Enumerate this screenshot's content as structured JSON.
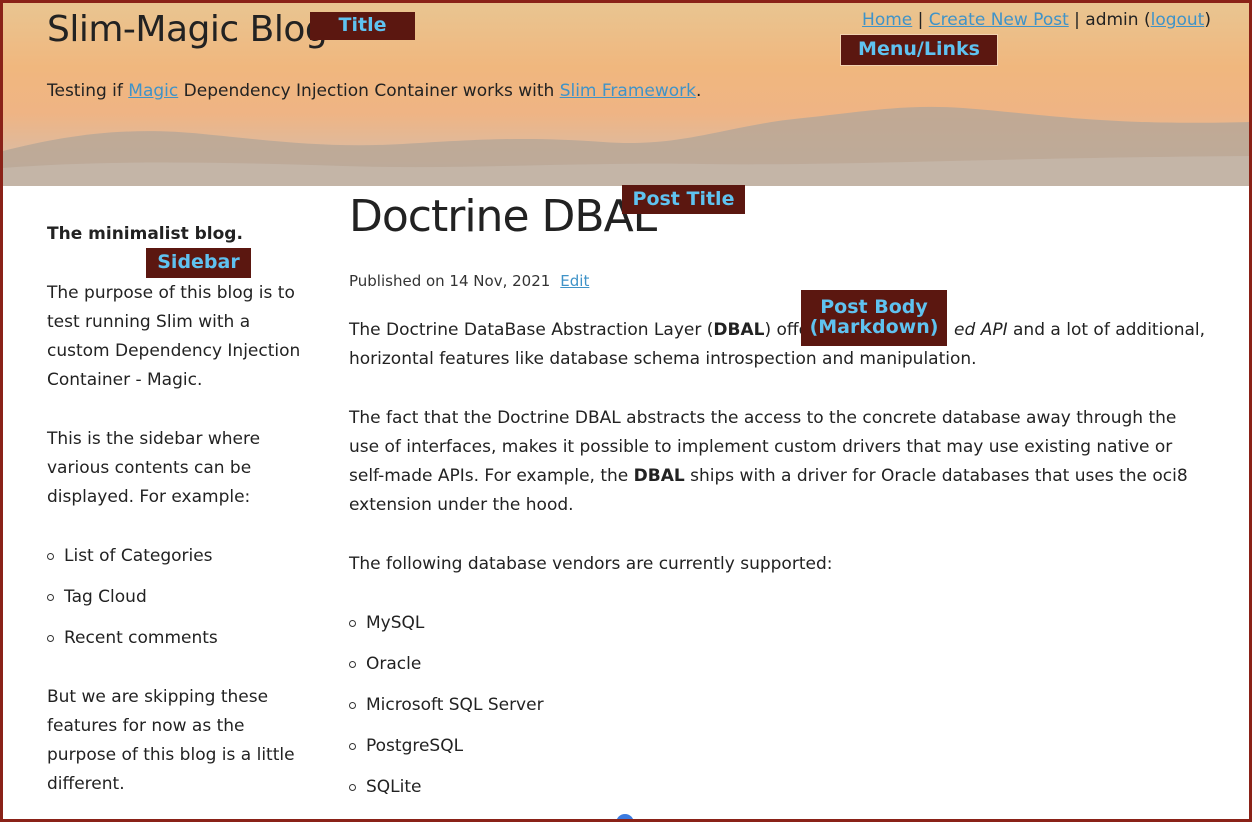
{
  "header": {
    "site_title": "Slim-Magic Blog",
    "tagline_before": "Testing if ",
    "tagline_link1": "Magic",
    "tagline_middle": " Dependency Injection Container works with ",
    "tagline_link2": "Slim Framework",
    "tagline_after": "."
  },
  "nav": {
    "home": "Home",
    "sep1": " | ",
    "create": "Create New Post",
    "sep2": " | admin (",
    "logout": "logout",
    "close": ")"
  },
  "annotations": {
    "title": "Title",
    "menu": "Menu/Links",
    "post_title": "Post Title",
    "sidebar": "Sidebar",
    "post_body_line1": "Post Body",
    "post_body_line2": "(Markdown)"
  },
  "sidebar": {
    "heading": "The minimalist blog.",
    "para1": "The purpose of this blog is to test running Slim with a custom Dependency Injection Container - Magic.",
    "para2": "This is the sidebar where various contents can be displayed. For example:",
    "items": [
      "List of Categories",
      "Tag Cloud",
      "Recent comments"
    ],
    "para3": "But we are skipping these features for now as the purpose of this blog is a little different."
  },
  "post": {
    "title": "Doctrine DBAL",
    "published": "Published on 14 Nov, 2021",
    "edit": "Edit",
    "p1_a": "The Doctrine DataBase Abstraction Layer (",
    "p1_b": "DBAL",
    "p1_c": ") offer",
    "p1_d": "ed API",
    "p1_e": " and a lot of additional, horizontal features like database schema introspection and manipulation.",
    "p2_a": "The fact that the Doctrine DBAL abstracts the access to the concrete database away through the use of interfaces, makes it possible to implement custom drivers that may use existing native or self-made APIs. For example, the ",
    "p2_b": "DBAL",
    "p2_c": " ships with a driver for Oracle databases that uses the oci8 extension under the hood.",
    "p3": "The following database vendors are currently supported:",
    "vendors": [
      "MySQL",
      "Oracle",
      "Microsoft SQL Server",
      "PostgreSQL",
      "SQLite"
    ]
  }
}
